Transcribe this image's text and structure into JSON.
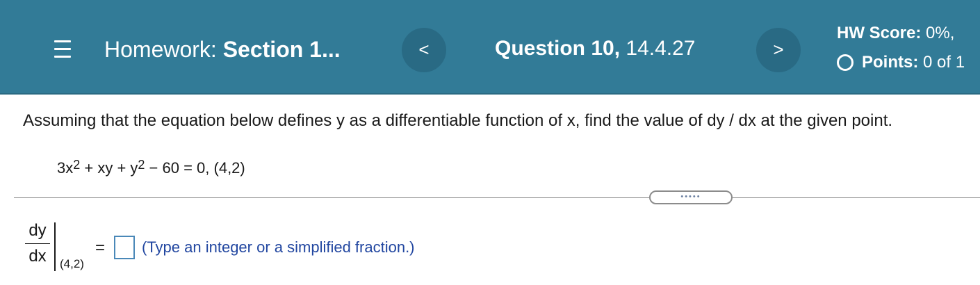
{
  "header": {
    "menu_icon": "hamburger-menu-icon",
    "homework_prefix": "Homework:",
    "homework_name": "Section 1...",
    "prev_label": "<",
    "next_label": ">",
    "question_number": "Question 10,",
    "question_id": "14.4.27",
    "score_label": "HW Score:",
    "score_value": "0%,",
    "points_label": "Points:",
    "points_value": "0 of 1",
    "points_icon": "empty-circle-icon",
    "background_color": "#327b97"
  },
  "question": {
    "instructions": "Assuming that the equation below defines y as a differentiable function of x, find the value of dy / dx at the given point.",
    "equation": {
      "part1": "3x",
      "exp1": "2",
      "part2": " + xy + y",
      "exp2": "2",
      "part3": " − 60 = 0, (4,2)"
    },
    "more_button": "•••••"
  },
  "answer": {
    "numerator": "dy",
    "denominator": "dx",
    "evaluated_at": "(4,2)",
    "equals": "=",
    "value": "",
    "hint": "(Type an integer or a simplified fraction.)",
    "hint_color": "#2146a0"
  }
}
